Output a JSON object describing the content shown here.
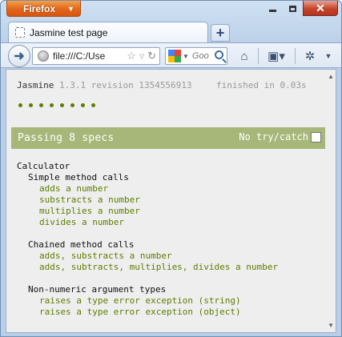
{
  "browser": {
    "app_button_label": "Firefox",
    "tab_title": "Jasmine test page",
    "new_tab_label": "+",
    "url": "file:///C:/Use",
    "search_placeholder": "Goo"
  },
  "icons": {
    "back": "back-arrow-icon",
    "globe": "globe-icon",
    "star": "bookmark-star-icon",
    "reload": "reload-icon",
    "home": "home-icon",
    "bookmarks": "bookmarks-menu-icon",
    "addon": "addon-icon"
  },
  "jasmine": {
    "title": "Jasmine",
    "version": "1.3.1 revision 1354556913",
    "duration": "finished in 0.03s",
    "passed_dots": 8,
    "status_text": "Passing 8 specs",
    "option_label": "No try/catch",
    "suite_root": "Calculator",
    "suites": [
      {
        "name": "Simple method calls",
        "specs": [
          "adds a number",
          "substracts a number",
          "multiplies a number",
          "divides a number"
        ]
      },
      {
        "name": "Chained method calls",
        "specs": [
          "adds, substracts a number",
          "adds, subtracts, multiplies, divides a number"
        ]
      },
      {
        "name": "Non-numeric argument types",
        "specs": [
          "raises a type error exception (string)",
          "raises a type error exception (object)"
        ]
      }
    ]
  },
  "colors": {
    "passing_bar": "#a6b779",
    "spec_text": "#5e7d00",
    "page_bg": "#eeeeee"
  }
}
